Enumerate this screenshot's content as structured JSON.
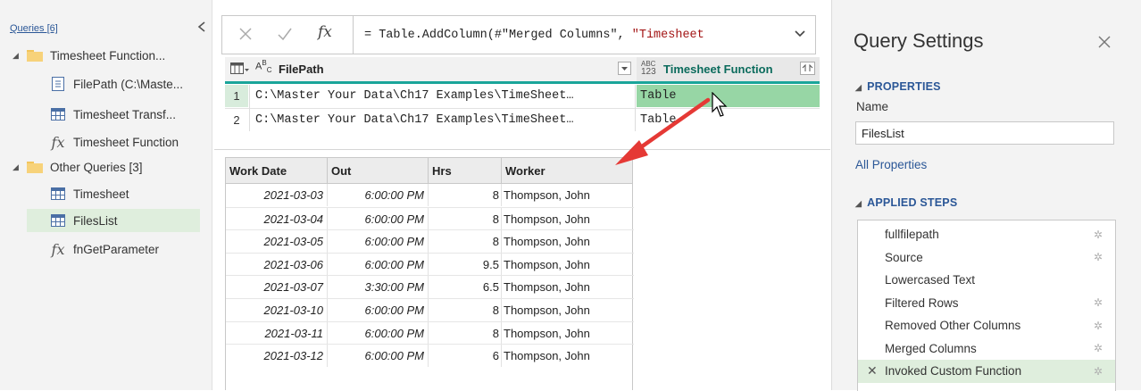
{
  "queries": {
    "title": "Queries [6]",
    "items": [
      {
        "label": "Timesheet Function...",
        "icon": "folder-icon",
        "kind": "group"
      },
      {
        "label": "FilePath (C:\\Maste...",
        "icon": "parameter-icon",
        "kind": "item"
      },
      {
        "label": "Timesheet Transf...",
        "icon": "table-icon",
        "kind": "item"
      },
      {
        "label": "Timesheet Function",
        "icon": "function-icon",
        "kind": "item"
      },
      {
        "label": "Other Queries [3]",
        "icon": "folder-icon",
        "kind": "group"
      },
      {
        "label": "Timesheet",
        "icon": "table-icon",
        "kind": "item"
      },
      {
        "label": "FilesList",
        "icon": "table-icon",
        "kind": "item",
        "selected": true
      },
      {
        "label": "fnGetParameter",
        "icon": "function-icon",
        "kind": "item"
      }
    ]
  },
  "formula_bar": {
    "fx": "fx",
    "prefix": "= Table.AddColumn(#\"Merged Columns\", ",
    "string_part": "\"Timesheet"
  },
  "preview": {
    "col1_type": "ABC",
    "col1_header": "FilePath",
    "col2_type_top": "ABC",
    "col2_type_bottom": "123",
    "col2_header": "Timesheet Function",
    "rows": [
      {
        "num": "1",
        "path": "C:\\Master Your Data\\Ch17 Examples\\TimeSheet…",
        "value": "Table"
      },
      {
        "num": "2",
        "path": "C:\\Master Your Data\\Ch17 Examples\\TimeSheet…",
        "value": "Table"
      }
    ]
  },
  "table": {
    "headers": [
      "Work Date",
      "Out",
      "Hrs",
      "Worker"
    ],
    "rows": [
      [
        "2021-03-03",
        "6:00:00 PM",
        "8",
        "Thompson, John"
      ],
      [
        "2021-03-04",
        "6:00:00 PM",
        "8",
        "Thompson, John"
      ],
      [
        "2021-03-05",
        "6:00:00 PM",
        "8",
        "Thompson, John"
      ],
      [
        "2021-03-06",
        "6:00:00 PM",
        "9.5",
        "Thompson, John"
      ],
      [
        "2021-03-07",
        "3:30:00 PM",
        "6.5",
        "Thompson, John"
      ],
      [
        "2021-03-10",
        "6:00:00 PM",
        "8",
        "Thompson, John"
      ],
      [
        "2021-03-11",
        "6:00:00 PM",
        "8",
        "Thompson, John"
      ],
      [
        "2021-03-12",
        "6:00:00 PM",
        "6",
        "Thompson, John"
      ]
    ]
  },
  "settings": {
    "title": "Query Settings",
    "properties_label": "PROPERTIES",
    "name_label": "Name",
    "name_value": "FilesList",
    "all_properties": "All Properties",
    "applied_steps_label": "APPLIED STEPS",
    "steps": [
      {
        "label": "fullfilepath",
        "gear": true
      },
      {
        "label": "Source",
        "gear": true
      },
      {
        "label": "Lowercased Text",
        "gear": false
      },
      {
        "label": "Filtered Rows",
        "gear": true
      },
      {
        "label": "Removed Other Columns",
        "gear": true
      },
      {
        "label": "Merged Columns",
        "gear": true
      },
      {
        "label": "Invoked Custom Function",
        "gear": true,
        "selected": true
      }
    ]
  },
  "colors": {
    "accent_green": "#97d6a5",
    "teal_bar": "#1aa59a",
    "arrow_red": "#e53935",
    "link_blue": "#2b5797"
  }
}
